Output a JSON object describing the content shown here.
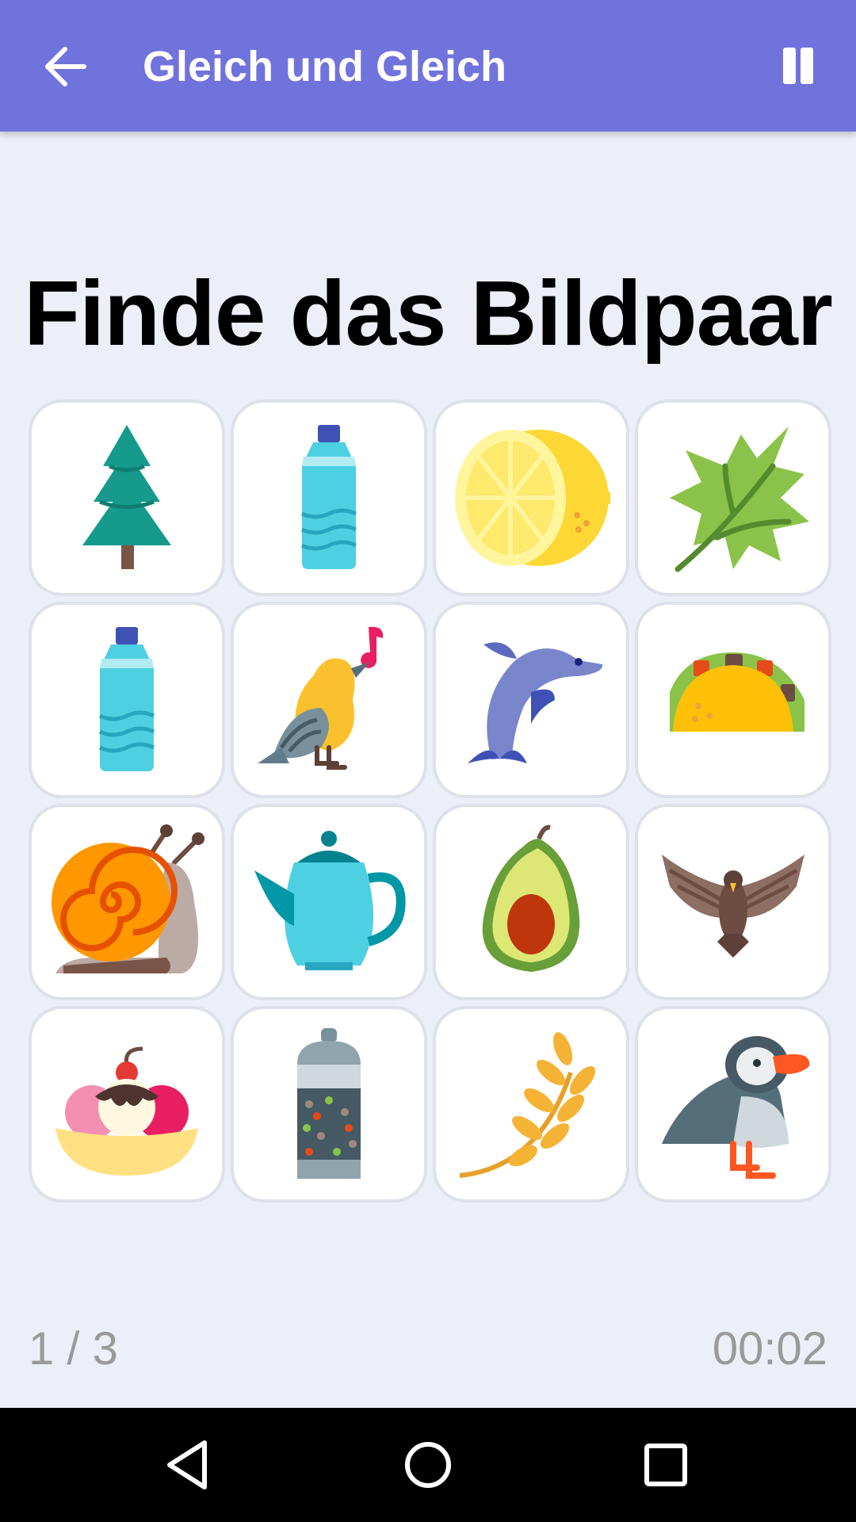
{
  "header": {
    "title": "Gleich und Gleich",
    "back_icon": "arrow-left-icon",
    "pause_icon": "pause-icon"
  },
  "prompt": "Finde das Bildpaar",
  "cards": [
    {
      "icon": "tree-icon"
    },
    {
      "icon": "water-bottle-icon"
    },
    {
      "icon": "lemon-icon"
    },
    {
      "icon": "leaf-icon"
    },
    {
      "icon": "water-bottle-icon"
    },
    {
      "icon": "singing-bird-icon"
    },
    {
      "icon": "dolphin-icon"
    },
    {
      "icon": "taco-icon"
    },
    {
      "icon": "snail-icon"
    },
    {
      "icon": "teapot-icon"
    },
    {
      "icon": "avocado-icon"
    },
    {
      "icon": "eagle-icon"
    },
    {
      "icon": "banana-split-icon"
    },
    {
      "icon": "pepper-grinder-icon"
    },
    {
      "icon": "wheat-icon"
    },
    {
      "icon": "puffin-icon"
    }
  ],
  "footer": {
    "progress": "1 / 3",
    "timer": "00:02"
  },
  "navbar": {
    "back": "nav-back-icon",
    "home": "nav-home-icon",
    "recents": "nav-recents-icon"
  },
  "colors": {
    "appbar": "#7173dc",
    "background": "#eceff7",
    "footer_text": "#9a9a9a"
  }
}
